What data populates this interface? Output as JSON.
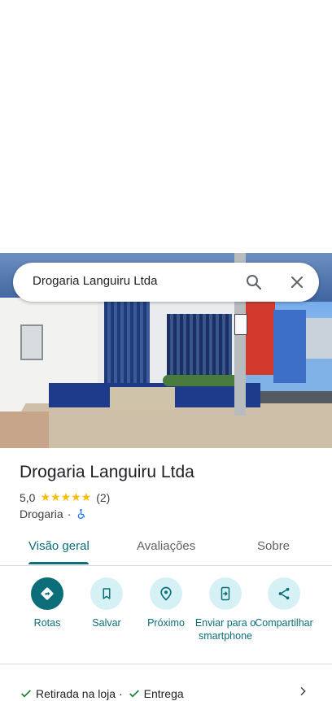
{
  "search": {
    "query": "Drogaria Languiru Ltda"
  },
  "place": {
    "name": "Drogaria Languiru Ltda",
    "rating": "5,0",
    "stars": "★★★★★",
    "review_count": "(2)",
    "category": "Drogaria",
    "separator": "·"
  },
  "tabs": [
    {
      "label": "Visão geral",
      "active": true
    },
    {
      "label": "Avaliações",
      "active": false
    },
    {
      "label": "Sobre",
      "active": false
    }
  ],
  "actions": [
    {
      "label": "Rotas",
      "icon": "directions-icon"
    },
    {
      "label": "Salvar",
      "icon": "bookmark-icon"
    },
    {
      "label": "Próximo",
      "icon": "nearby-icon"
    },
    {
      "label": "Enviar para o smartphone",
      "icon": "send-to-phone-icon"
    },
    {
      "label": "Compartilhar",
      "icon": "share-icon"
    }
  ],
  "services": {
    "pickup": "Retirada na loja ·",
    "delivery": "Entrega"
  },
  "colors": {
    "accent": "#0b6e79",
    "action_bg": "#d6f1f6",
    "star": "#fbbc04",
    "check": "#188038"
  }
}
